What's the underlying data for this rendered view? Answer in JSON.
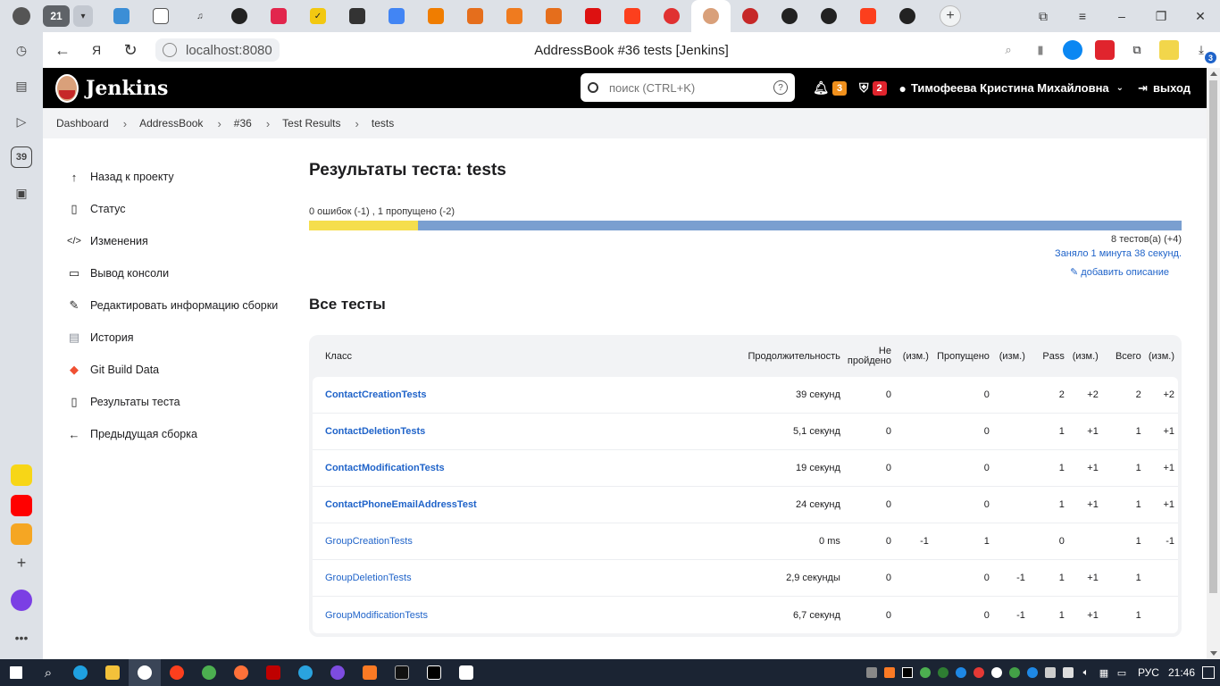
{
  "browser": {
    "tab_count": "21",
    "page_title": "AddressBook #36 tests [Jenkins]",
    "url": "localhost:8080",
    "download_count": "3",
    "sidebar_badge": "39"
  },
  "jenkins": {
    "title": "Jenkins",
    "search_placeholder": "поиск (CTRL+K)",
    "search_help": "?",
    "notifications_count": "3",
    "security_count": "2",
    "user_name": "Тимофеева Кристина Михайловна",
    "logout_label": "выход"
  },
  "breadcrumbs": [
    "Dashboard",
    "AddressBook",
    "#36",
    "Test Results",
    "tests"
  ],
  "sidebar": {
    "items": [
      {
        "label": "Назад к проекту",
        "icon": "arrow-up-icon"
      },
      {
        "label": "Статус",
        "icon": "document-icon"
      },
      {
        "label": "Изменения",
        "icon": "code-icon"
      },
      {
        "label": "Вывод консоли",
        "icon": "terminal-icon"
      },
      {
        "label": "Редактировать информацию сборки",
        "icon": "edit-icon"
      },
      {
        "label": "История",
        "icon": "history-icon"
      },
      {
        "label": "Git Build Data",
        "icon": "git-icon"
      },
      {
        "label": "Результаты теста",
        "icon": "clipboard-icon"
      },
      {
        "label": "Предыдущая сборка",
        "icon": "arrow-left-icon"
      }
    ]
  },
  "results": {
    "heading": "Результаты теста: tests",
    "summary": "0 ошибок (-1) , 1 пропущено (-2)",
    "skipped_fraction": 0.125,
    "total_tests": "8 тестов(а) (+4)",
    "duration": "Заняло 1 минута 38 секунд.",
    "add_description": "добавить описание",
    "all_tests_heading": "Все тесты"
  },
  "table": {
    "headers": {
      "class": "Класс",
      "duration": "Продолжительность",
      "failed": "Не пройдено",
      "failed_diff": "(изм.)",
      "skipped": "Пропущено",
      "skipped_diff": "(изм.)",
      "pass": "Pass",
      "pass_diff": "(изм.)",
      "total": "Всего",
      "total_diff": "(изм.)"
    },
    "rows": [
      {
        "name": "ContactCreationTests",
        "bold": true,
        "duration": "39 секунд",
        "failed": "0",
        "failed_diff": "",
        "skipped": "0",
        "skipped_diff": "",
        "pass": "2",
        "pass_diff": "+2",
        "total": "2",
        "total_diff": "+2"
      },
      {
        "name": "ContactDeletionTests",
        "bold": true,
        "duration": "5,1 секунд",
        "failed": "0",
        "failed_diff": "",
        "skipped": "0",
        "skipped_diff": "",
        "pass": "1",
        "pass_diff": "+1",
        "total": "1",
        "total_diff": "+1"
      },
      {
        "name": "ContactModificationTests",
        "bold": true,
        "duration": "19 секунд",
        "failed": "0",
        "failed_diff": "",
        "skipped": "0",
        "skipped_diff": "",
        "pass": "1",
        "pass_diff": "+1",
        "total": "1",
        "total_diff": "+1"
      },
      {
        "name": "ContactPhoneEmailAddressTest",
        "bold": true,
        "duration": "24 секунд",
        "failed": "0",
        "failed_diff": "",
        "skipped": "0",
        "skipped_diff": "",
        "pass": "1",
        "pass_diff": "+1",
        "total": "1",
        "total_diff": "+1"
      },
      {
        "name": "GroupCreationTests",
        "bold": false,
        "duration": "0 ms",
        "failed": "0",
        "failed_diff": "-1",
        "skipped": "1",
        "skipped_diff": "",
        "pass": "0",
        "pass_diff": "",
        "total": "1",
        "total_diff": "-1"
      },
      {
        "name": "GroupDeletionTests",
        "bold": false,
        "duration": "2,9 секунды",
        "failed": "0",
        "failed_diff": "",
        "skipped": "0",
        "skipped_diff": "-1",
        "pass": "1",
        "pass_diff": "+1",
        "total": "1",
        "total_diff": ""
      },
      {
        "name": "GroupModificationTests",
        "bold": false,
        "duration": "6,7 секунд",
        "failed": "0",
        "failed_diff": "",
        "skipped": "0",
        "skipped_diff": "-1",
        "pass": "1",
        "pass_diff": "+1",
        "total": "1",
        "total_diff": ""
      }
    ]
  },
  "taskbar": {
    "language": "РУС",
    "time": "21:46"
  },
  "colors": {
    "progress_skipped": "#f5de4d",
    "progress_passed": "#7a9fd0",
    "link": "#1f63c9",
    "notifications_badge": "#f0901c",
    "security_badge": "#e0242d"
  }
}
